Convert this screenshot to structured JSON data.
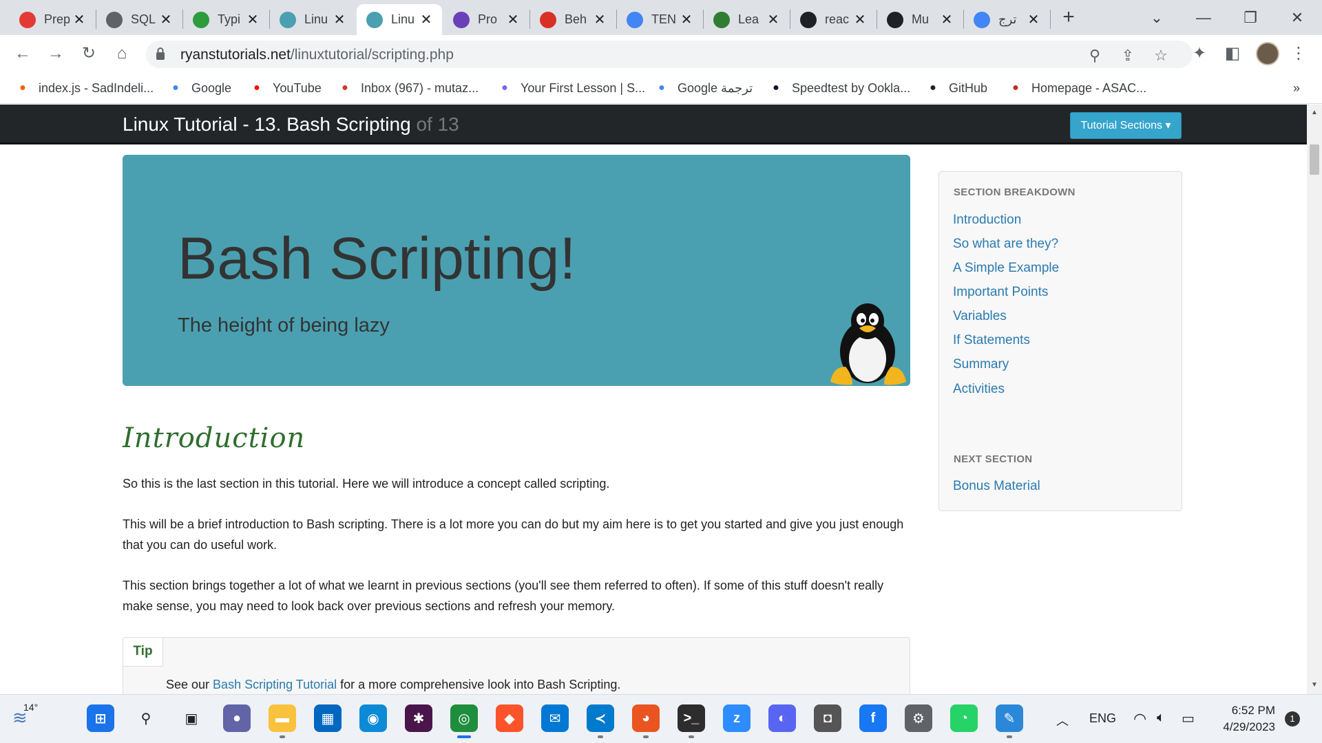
{
  "browser": {
    "tabs": [
      {
        "label": "Prep",
        "color": "#e53935"
      },
      {
        "label": "SQL",
        "color": "#5f6368"
      },
      {
        "label": "Typi",
        "color": "#2e9c3c"
      },
      {
        "label": "Linu",
        "color": "#4aa0b0"
      },
      {
        "label": "Linu",
        "color": "#4aa0b0"
      },
      {
        "label": "Pro",
        "color": "#6b3fb8"
      },
      {
        "label": "Beh",
        "color": "#d93025"
      },
      {
        "label": "TEN",
        "color": "#4285f4"
      },
      {
        "label": "Lea",
        "color": "#2e7d32"
      },
      {
        "label": "reac",
        "color": "#202124"
      },
      {
        "label": "Mu",
        "color": "#202124"
      },
      {
        "label": "ترج",
        "color": "#4285f4"
      }
    ],
    "url_domain": "ryanstutorials.net",
    "url_path": "/linuxtutorial/scripting.php",
    "bookmarks": [
      {
        "label": "index.js - SadIndeli...",
        "icon": "replit-icon",
        "color": "#f26207"
      },
      {
        "label": "Google",
        "icon": "google-icon",
        "color": "#4285f4"
      },
      {
        "label": "YouTube",
        "icon": "youtube-icon",
        "color": "#ff0000"
      },
      {
        "label": "Inbox (967) - mutaz...",
        "icon": "gmail-icon",
        "color": "#d93025"
      },
      {
        "label": "Your First Lesson | S...",
        "icon": "lesson-icon",
        "color": "#7b61ff"
      },
      {
        "label": "Google ترجمة",
        "icon": "translate-icon",
        "color": "#4285f4"
      },
      {
        "label": "Speedtest by Ookla...",
        "icon": "speedtest-icon",
        "color": "#141526"
      },
      {
        "label": "GitHub",
        "icon": "github-icon",
        "color": "#202124"
      },
      {
        "label": "Homepage - ASAC...",
        "icon": "asac-icon",
        "color": "#c62828"
      }
    ],
    "more_bookmarks": "»"
  },
  "site": {
    "brand": "Linux Tutorial - 13. Bash Scripting",
    "brand_suffix": "of 13",
    "sections_button": "Tutorial Sections ▾",
    "hero_title": "Bash Scripting!",
    "hero_tagline": "The height of being lazy",
    "intro_heading": "Introduction",
    "paragraphs": [
      "So this is the last section in this tutorial. Here we will introduce a concept called scripting.",
      "This will be a brief introduction to Bash scripting. There is a lot more you can do but my aim here is to get you started and give you just enough that you can do useful work.",
      "This section brings together a lot of what we learnt in previous sections (you'll see them referred to often). If some of this stuff doesn't really make sense, you may need to look back over previous sections and refresh your memory."
    ],
    "tip_label": "Tip",
    "tip_prefix": "See our ",
    "tip_link": "Bash Scripting Tutorial",
    "tip_suffix": " for a more comprehensive look into Bash Scripting.",
    "sidebar": {
      "heading": "SECTION BREAKDOWN",
      "links": [
        "Introduction",
        "So what are they?",
        "A Simple Example",
        "Important Points",
        "Variables",
        "If Statements",
        "Summary",
        "Activities"
      ],
      "next_heading": "NEXT SECTION",
      "next_link": "Bonus Material"
    }
  },
  "taskbar": {
    "weather": "14°",
    "language": "ENG",
    "time": "6:52 PM",
    "date": "4/29/2023",
    "notifications": "1",
    "apps": [
      {
        "name": "start-icon",
        "color": "#1a73e8"
      },
      {
        "name": "search-icon",
        "color": "#202124"
      },
      {
        "name": "task-view-icon",
        "color": "#202124"
      },
      {
        "name": "teams-chat-icon",
        "color": "#6264a7"
      },
      {
        "name": "file-explorer-icon",
        "color": "#f9c23c"
      },
      {
        "name": "microsoft-store-icon",
        "color": "#0067c0"
      },
      {
        "name": "edge-icon",
        "color": "#0c8ad6"
      },
      {
        "name": "slack-icon",
        "color": "#4a154b"
      },
      {
        "name": "chrome-icon",
        "color": "#1e8e3e"
      },
      {
        "name": "brave-icon",
        "color": "#fb542b"
      },
      {
        "name": "mail-icon",
        "color": "#0078d4"
      },
      {
        "name": "vscode-icon",
        "color": "#007acc"
      },
      {
        "name": "ubuntu-icon",
        "color": "#e95420"
      },
      {
        "name": "terminal-icon",
        "color": "#2d2d2d"
      },
      {
        "name": "zoom-icon",
        "color": "#2d8cff"
      },
      {
        "name": "discord-icon",
        "color": "#5865f2"
      },
      {
        "name": "camera-icon",
        "color": "#555555"
      },
      {
        "name": "facebook-icon",
        "color": "#1877f2"
      },
      {
        "name": "settings-icon",
        "color": "#5f6368"
      },
      {
        "name": "whatsapp-icon",
        "color": "#25d366"
      },
      {
        "name": "paint-icon",
        "color": "#2b88d8"
      }
    ]
  }
}
